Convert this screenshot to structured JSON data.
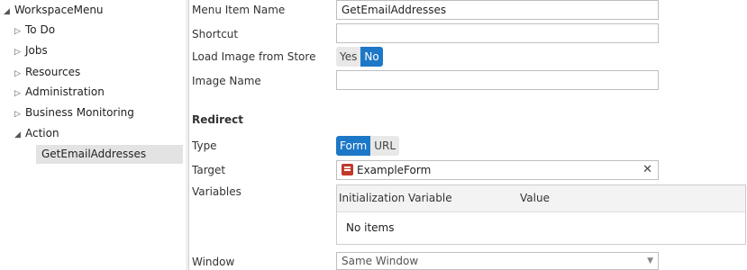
{
  "tree": {
    "root": "WorkspaceMenu",
    "items": [
      {
        "label": "To Do"
      },
      {
        "label": "Jobs"
      },
      {
        "label": "Resources"
      },
      {
        "label": "Administration"
      },
      {
        "label": "Business Monitoring"
      },
      {
        "label": "Action"
      }
    ],
    "child": "GetEmailAddresses"
  },
  "form": {
    "menu_item_name_label": "Menu Item Name",
    "menu_item_name_value": "GetEmailAddresses",
    "shortcut_label": "Shortcut",
    "shortcut_value": "",
    "load_image_label": "Load Image from Store",
    "load_image_yes": "Yes",
    "load_image_no": "No",
    "image_name_label": "Image Name",
    "image_name_value": "",
    "redirect_heading": "Redirect",
    "type_label": "Type",
    "type_form": "Form",
    "type_url": "URL",
    "target_label": "Target",
    "target_value": "ExampleForm",
    "variables_label": "Variables",
    "grid_col1": "Initialization Variable",
    "grid_col2": "Value",
    "grid_empty": "No items",
    "window_label": "Window",
    "window_value": "Same Window"
  },
  "icons": {
    "clear": "close-icon",
    "target": "form-icon",
    "dropdown": "chevron-down-icon"
  },
  "colors": {
    "accent": "#1d78c7",
    "form_icon": "#c0392b"
  }
}
